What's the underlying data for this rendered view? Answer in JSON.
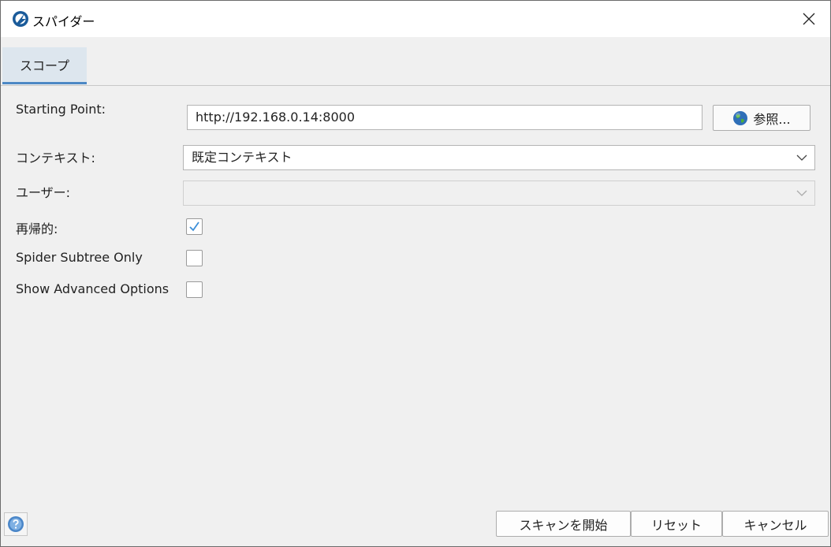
{
  "window": {
    "title": "スパイダー",
    "app_icon": "zap-logo-icon",
    "close_icon": "close-icon"
  },
  "tabs": [
    {
      "label": "スコープ",
      "selected": true
    }
  ],
  "form": {
    "starting_point": {
      "label": "Starting Point:",
      "value": "http://192.168.0.14:8000"
    },
    "browse": {
      "label": "参照...",
      "icon": "globe-icon"
    },
    "context": {
      "label": "コンテキスト:",
      "value": "既定コンテキスト"
    },
    "user": {
      "label": "ユーザー:",
      "value": "",
      "disabled": true
    },
    "recurse": {
      "label": "再帰的:",
      "checked": true
    },
    "subtree_only": {
      "label": "Spider Subtree Only",
      "checked": false
    },
    "advanced": {
      "label": "Show Advanced Options",
      "checked": false
    }
  },
  "footer": {
    "help_icon": "help-icon",
    "start_label": "スキャンを開始",
    "reset_label": "リセット",
    "cancel_label": "キャンセル"
  },
  "colors": {
    "accent": "#4c88c4",
    "tab_bg": "#dde6ee",
    "window_bg": "#f0f0f0",
    "check": "#3d8fd8"
  }
}
